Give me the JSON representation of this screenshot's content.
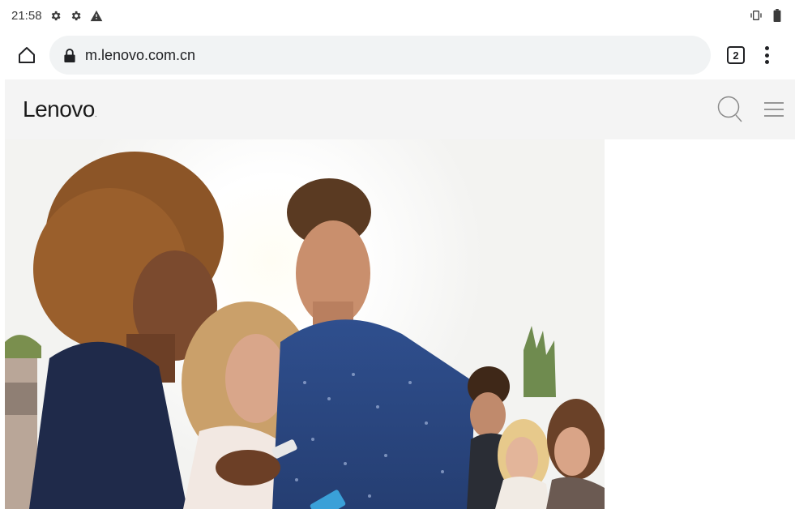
{
  "status_bar": {
    "time": "21:58",
    "icons_left": [
      "settings-icon",
      "settings-icon",
      "warning-icon"
    ],
    "icons_right": [
      "vibrate-icon",
      "battery-icon"
    ]
  },
  "browser": {
    "url": "m.lenovo.com.cn",
    "tab_count": "2"
  },
  "site": {
    "logo_text": "Lenovo",
    "logo_dot": "."
  },
  "hero": {
    "description": "hero-photo"
  }
}
